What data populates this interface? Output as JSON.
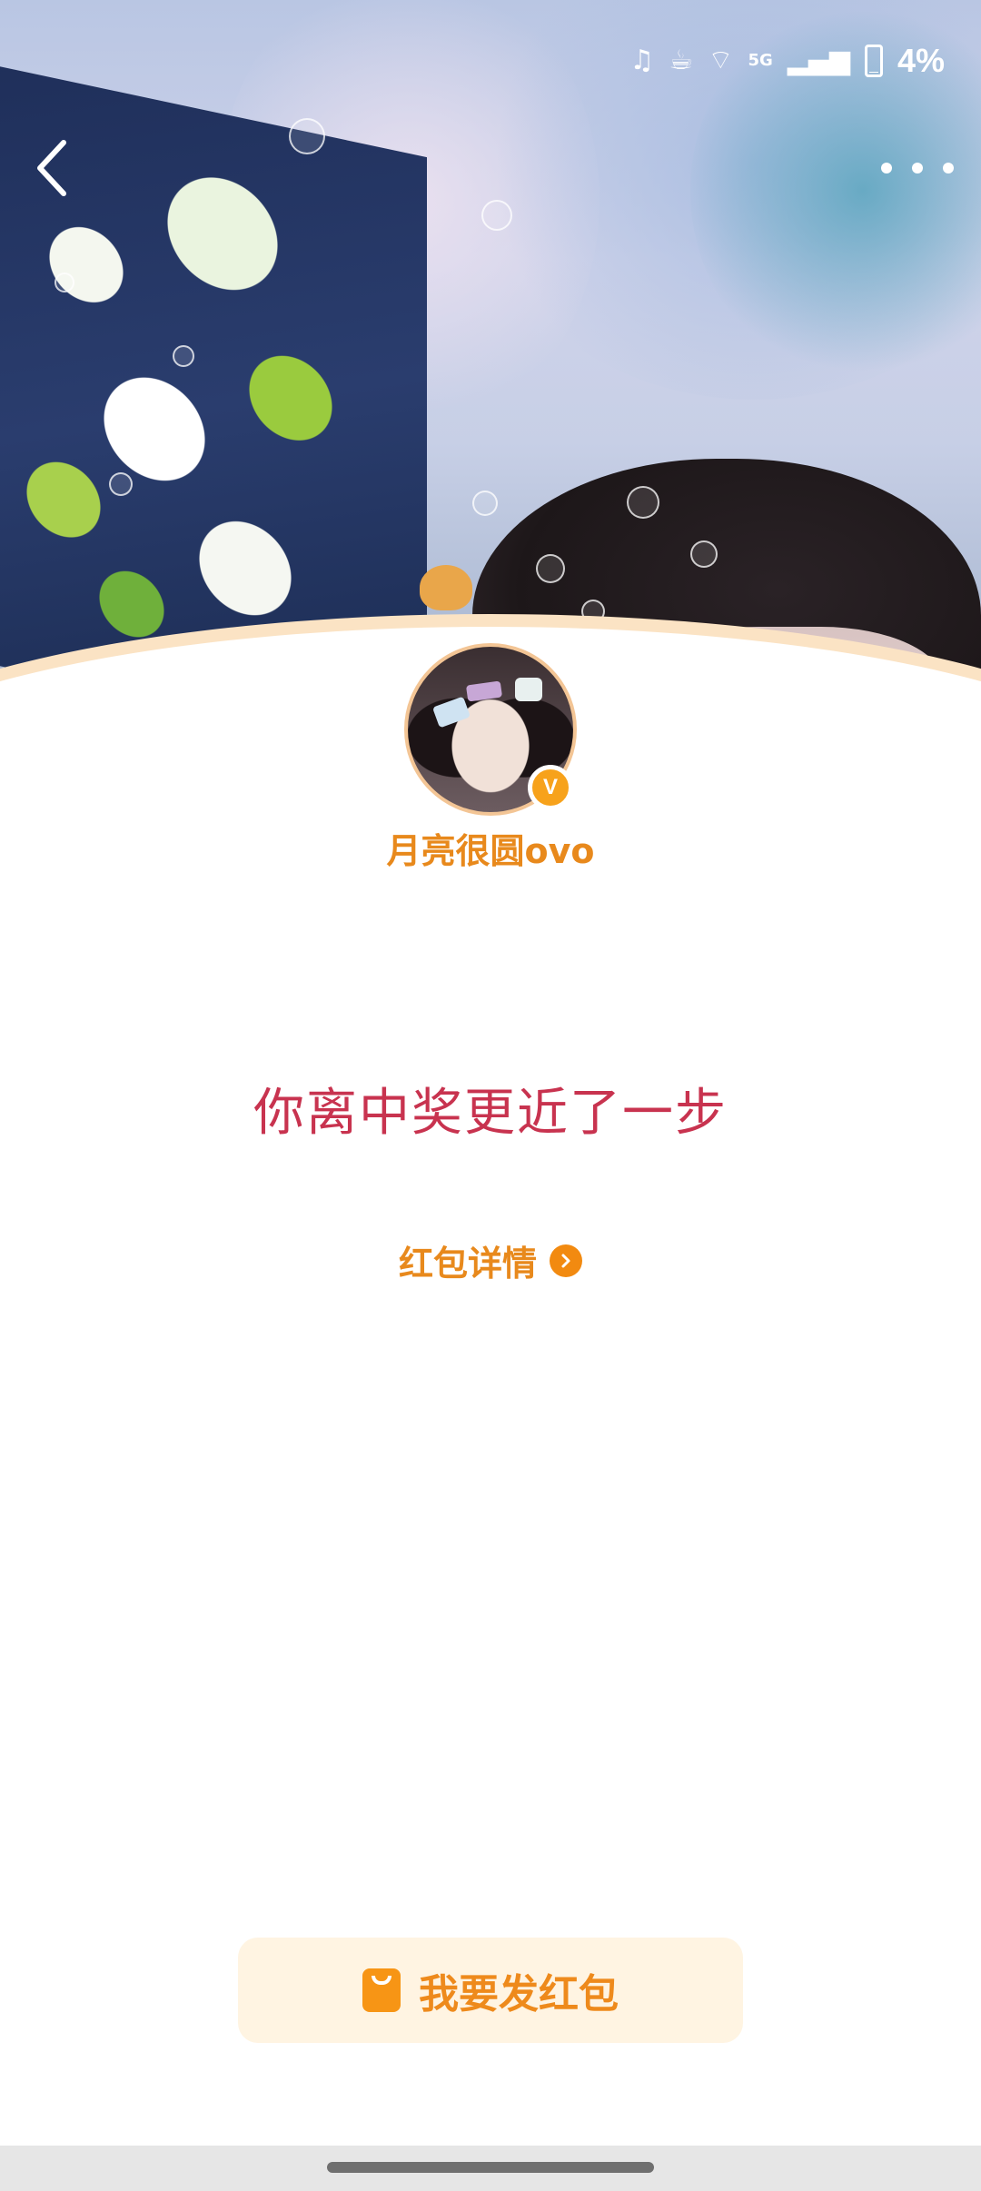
{
  "status_bar": {
    "network_label": "5G",
    "battery_text": "4%",
    "battery_level": 0.04,
    "icons": [
      "notification-bell-icon",
      "app-notification-icon",
      "wifi-icon",
      "signal-icon",
      "battery-charging-icon"
    ]
  },
  "nav": {
    "back_icon": "chevron-left-icon",
    "more_icon": "more-horizontal-icon"
  },
  "profile": {
    "username": "月亮很圆ovo",
    "verified_mark": "V"
  },
  "result": {
    "message": "你离中奖更近了一步"
  },
  "detail_link": {
    "label": "红包详情",
    "icon": "chevron-right-circle-icon"
  },
  "cta": {
    "label": "我要发红包",
    "icon": "red-envelope-icon"
  },
  "colors": {
    "accent_orange": "#e8891c",
    "result_red": "#c8334f",
    "cta_background": "#fff4e2",
    "badge_orange": "#f7a21b"
  }
}
